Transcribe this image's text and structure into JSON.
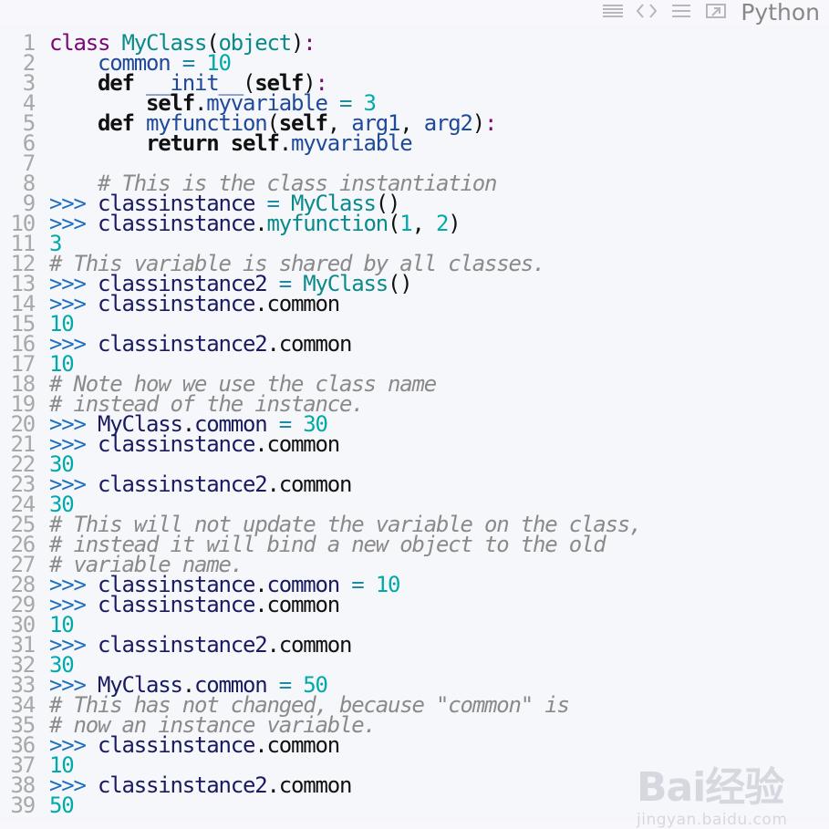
{
  "toolbar": {
    "icons": [
      "view-source-icon",
      "code-icon",
      "wrap-icon",
      "open-window-icon"
    ],
    "language": "Python"
  },
  "code_lines": [
    [
      [
        "kw",
        "class "
      ],
      [
        "cls",
        "MyClass"
      ],
      [
        "plain",
        "("
      ],
      [
        "cls",
        "object"
      ],
      [
        "plain",
        ")"
      ],
      [
        "kw",
        ":"
      ]
    ],
    [
      [
        "plain",
        "    "
      ],
      [
        "attr",
        "common"
      ],
      [
        "op",
        " = "
      ],
      [
        "num",
        "10"
      ]
    ],
    [
      [
        "plain",
        "    "
      ],
      [
        "kb",
        "def "
      ],
      [
        "attr",
        "__init__"
      ],
      [
        "plain",
        "("
      ],
      [
        "self",
        "self"
      ],
      [
        "plain",
        ")"
      ],
      [
        "kw",
        ":"
      ]
    ],
    [
      [
        "plain",
        "        "
      ],
      [
        "self",
        "self"
      ],
      [
        "dot",
        "."
      ],
      [
        "attr",
        "myvariable"
      ],
      [
        "op",
        " = "
      ],
      [
        "num",
        "3"
      ]
    ],
    [
      [
        "plain",
        "    "
      ],
      [
        "kb",
        "def "
      ],
      [
        "attr",
        "myfunction"
      ],
      [
        "plain",
        "("
      ],
      [
        "self",
        "self"
      ],
      [
        "plain",
        ", "
      ],
      [
        "attr",
        "arg1"
      ],
      [
        "plain",
        ", "
      ],
      [
        "attr",
        "arg2"
      ],
      [
        "plain",
        ")"
      ],
      [
        "kw",
        ":"
      ]
    ],
    [
      [
        "plain",
        "        "
      ],
      [
        "kb",
        "return "
      ],
      [
        "self",
        "self"
      ],
      [
        "dot",
        "."
      ],
      [
        "attr",
        "myvariable"
      ]
    ],
    [],
    [
      [
        "plain",
        "    "
      ],
      [
        "com",
        "# This is the class instantiation"
      ]
    ],
    [
      [
        "prompt",
        ">>> "
      ],
      [
        "ident",
        "classinstance"
      ],
      [
        "op",
        " = "
      ],
      [
        "cls",
        "MyClass"
      ],
      [
        "plain",
        "()"
      ]
    ],
    [
      [
        "prompt",
        ">>> "
      ],
      [
        "ident",
        "classinstance"
      ],
      [
        "dot",
        "."
      ],
      [
        "cls",
        "myfunction"
      ],
      [
        "plain",
        "("
      ],
      [
        "num",
        "1"
      ],
      [
        "plain",
        ", "
      ],
      [
        "num",
        "2"
      ],
      [
        "plain",
        ")"
      ]
    ],
    [
      [
        "out",
        "3"
      ]
    ],
    [
      [
        "com",
        "# This variable is shared by all classes."
      ]
    ],
    [
      [
        "prompt",
        ">>> "
      ],
      [
        "ident",
        "classinstance2"
      ],
      [
        "op",
        " = "
      ],
      [
        "cls",
        "MyClass"
      ],
      [
        "plain",
        "()"
      ]
    ],
    [
      [
        "prompt",
        ">>> "
      ],
      [
        "ident",
        "classinstance"
      ],
      [
        "dot",
        "."
      ],
      [
        "plain",
        "common"
      ]
    ],
    [
      [
        "out",
        "10"
      ]
    ],
    [
      [
        "prompt",
        ">>> "
      ],
      [
        "ident",
        "classinstance2"
      ],
      [
        "dot",
        "."
      ],
      [
        "plain",
        "common"
      ]
    ],
    [
      [
        "out",
        "10"
      ]
    ],
    [
      [
        "com",
        "# Note how we use the class name"
      ]
    ],
    [
      [
        "com",
        "# instead of the instance."
      ]
    ],
    [
      [
        "prompt",
        ">>> "
      ],
      [
        "ident",
        "MyClass"
      ],
      [
        "dot",
        "."
      ],
      [
        "ident",
        "common"
      ],
      [
        "op",
        " = "
      ],
      [
        "num",
        "30"
      ]
    ],
    [
      [
        "prompt",
        ">>> "
      ],
      [
        "ident",
        "classinstance"
      ],
      [
        "dot",
        "."
      ],
      [
        "plain",
        "common"
      ]
    ],
    [
      [
        "out",
        "30"
      ]
    ],
    [
      [
        "prompt",
        ">>> "
      ],
      [
        "ident",
        "classinstance2"
      ],
      [
        "dot",
        "."
      ],
      [
        "plain",
        "common"
      ]
    ],
    [
      [
        "out",
        "30"
      ]
    ],
    [
      [
        "com",
        "# This will not update the variable on the class,"
      ]
    ],
    [
      [
        "com",
        "# instead it will bind a new object to the old"
      ]
    ],
    [
      [
        "com",
        "# variable name."
      ]
    ],
    [
      [
        "prompt",
        ">>> "
      ],
      [
        "ident",
        "classinstance"
      ],
      [
        "dot",
        "."
      ],
      [
        "ident",
        "common"
      ],
      [
        "op",
        " = "
      ],
      [
        "num",
        "10"
      ]
    ],
    [
      [
        "prompt",
        ">>> "
      ],
      [
        "ident",
        "classinstance"
      ],
      [
        "dot",
        "."
      ],
      [
        "plain",
        "common"
      ]
    ],
    [
      [
        "out",
        "10"
      ]
    ],
    [
      [
        "prompt",
        ">>> "
      ],
      [
        "ident",
        "classinstance2"
      ],
      [
        "dot",
        "."
      ],
      [
        "plain",
        "common"
      ]
    ],
    [
      [
        "out",
        "30"
      ]
    ],
    [
      [
        "prompt",
        ">>> "
      ],
      [
        "ident",
        "MyClass"
      ],
      [
        "dot",
        "."
      ],
      [
        "ident",
        "common"
      ],
      [
        "op",
        " = "
      ],
      [
        "num",
        "50"
      ]
    ],
    [
      [
        "com",
        "# This has not changed, because \"common\" is"
      ]
    ],
    [
      [
        "com",
        "# now an instance variable."
      ]
    ],
    [
      [
        "prompt",
        ">>> "
      ],
      [
        "ident",
        "classinstance"
      ],
      [
        "dot",
        "."
      ],
      [
        "plain",
        "common"
      ]
    ],
    [
      [
        "out",
        "10"
      ]
    ],
    [
      [
        "prompt",
        ">>> "
      ],
      [
        "ident",
        "classinstance2"
      ],
      [
        "dot",
        "."
      ],
      [
        "plain",
        "common"
      ]
    ],
    [
      [
        "out",
        "50"
      ]
    ]
  ],
  "watermark": {
    "main": "Bai经验",
    "sub": "jingyan.baidu.com"
  },
  "colors": {
    "keyword": "#7a0874",
    "class_name": "#0a8a8a",
    "number": "#00aaaa",
    "comment": "#8a8a8a",
    "prompt": "#1f6fbf",
    "gutter": "#a8a8a8"
  }
}
